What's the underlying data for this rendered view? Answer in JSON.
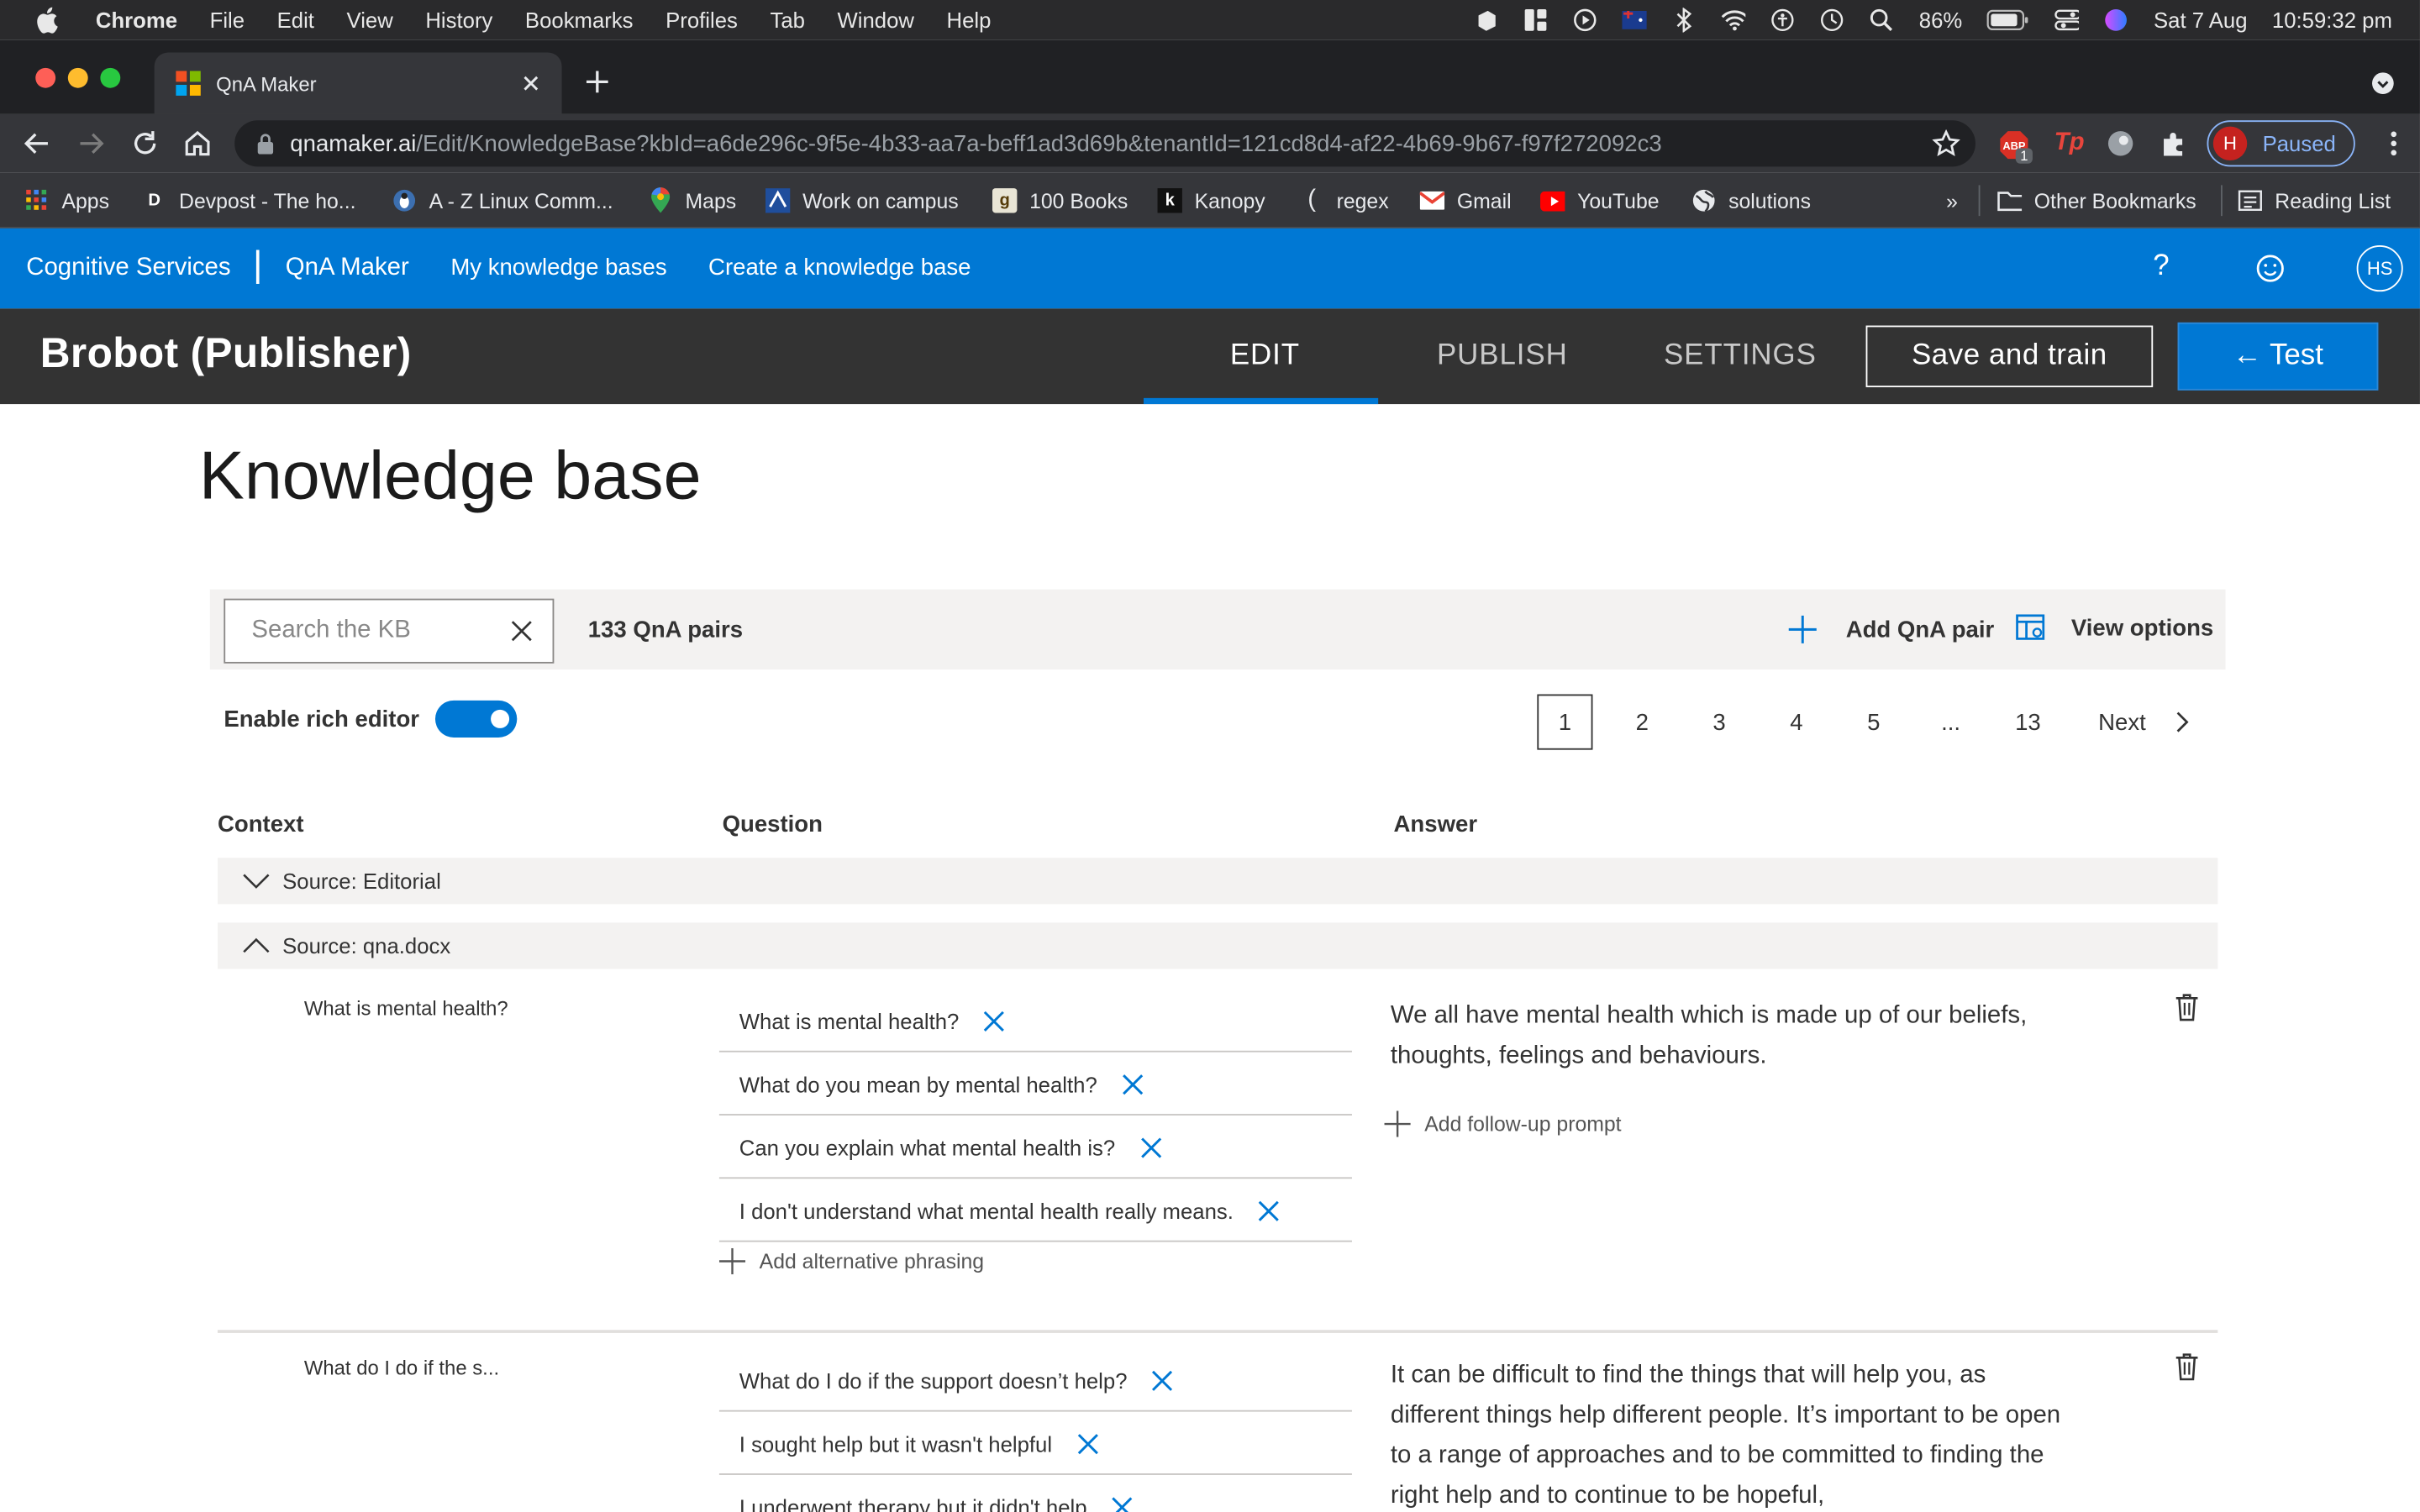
{
  "mac_menubar": {
    "app_name": "Chrome",
    "menus": [
      "File",
      "Edit",
      "View",
      "History",
      "Bookmarks",
      "Profiles",
      "Tab",
      "Window",
      "Help"
    ],
    "battery": "86%",
    "date": "Sat 7 Aug",
    "time": "10:59:32 pm"
  },
  "browser": {
    "tab_title": "QnA Maker",
    "url_host": "qnamaker.ai",
    "url_path": "/Edit/KnowledgeBase?kbId=a6de296c-9f5e-4b33-aa7a-beff1ad3d69b&tenantId=121cd8d4-af22-4b69-9b67-f97f272092c3",
    "profile_initial": "H",
    "profile_status": "Paused",
    "ext_badge": "1",
    "bookmarks": [
      {
        "label": "Apps",
        "icon": "apps-grid-icon"
      },
      {
        "label": "Devpost - The ho...",
        "icon": "devpost-icon"
      },
      {
        "label": "A - Z Linux Comm...",
        "icon": "linux-icon"
      },
      {
        "label": "Maps",
        "icon": "maps-pin-icon"
      },
      {
        "label": "Work on campus",
        "icon": "campus-icon"
      },
      {
        "label": "100 Books",
        "icon": "goodreads-icon"
      },
      {
        "label": "Kanopy",
        "icon": "kanopy-icon"
      },
      {
        "label": "regex",
        "icon": "regex-icon"
      },
      {
        "label": "Gmail",
        "icon": "gmail-icon"
      },
      {
        "label": "YouTube",
        "icon": "youtube-icon"
      },
      {
        "label": "solutions",
        "icon": "globe-icon"
      }
    ],
    "overflow": "»",
    "other_bookmarks": "Other Bookmarks",
    "reading_list": "Reading List"
  },
  "azure_nav": {
    "brand": "Cognitive Services",
    "product": "QnA Maker",
    "links": [
      "My knowledge bases",
      "Create a knowledge base"
    ],
    "help": "?",
    "user_initials": "HS"
  },
  "kb_header": {
    "title": "Brobot (Publisher)",
    "tabs": [
      "EDIT",
      "PUBLISH",
      "SETTINGS"
    ],
    "active_tab": "EDIT",
    "save_train": "Save and train",
    "test": "← Test"
  },
  "kb": {
    "page_title": "Knowledge base",
    "search_placeholder": "Search the KB",
    "pair_count": "133 QnA pairs",
    "add_pair": "Add QnA pair",
    "view_options": "View options",
    "rich_editor_label": "Enable rich editor",
    "rich_editor_on": true,
    "pages": [
      "1",
      "2",
      "3",
      "4",
      "5",
      "...",
      "13"
    ],
    "current_page": "1",
    "next": "Next",
    "columns": [
      "Context",
      "Question",
      "Answer"
    ],
    "sources": [
      {
        "label": "Source: Editorial",
        "expanded": false
      },
      {
        "label": "Source: qna.docx",
        "expanded": true
      }
    ],
    "pairs": [
      {
        "context": "What is mental health?",
        "questions": [
          "What is mental health?",
          "What do you mean by mental health?",
          "Can you explain what mental health is?",
          "I don't understand what mental health really means."
        ],
        "add_alt": "Add alternative phrasing",
        "answer": "We all have mental health which is made up of our beliefs, thoughts, feelings and behaviours.",
        "add_follow": "Add follow-up prompt"
      },
      {
        "context": "What do I do if the s...",
        "questions": [
          "What do I do if the support doesn’t help?",
          "I sought help but it wasn't helpful",
          "I underwent therapy but it didn't help"
        ],
        "answer": "It can be difficult to find the things that will help you, as different things help different people. It’s important to be open to a range of approaches and to be committed to finding the right help and to continue to be hopeful,"
      }
    ]
  },
  "colors": {
    "azure_blue": "#0078d4",
    "dark_header": "#333333",
    "chrome_dark": "#35363a"
  }
}
